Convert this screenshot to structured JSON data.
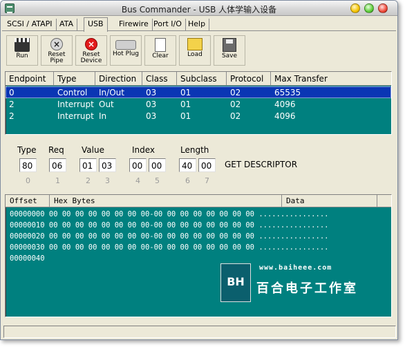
{
  "window": {
    "title": "Bus Commander - USB 人体学输入设备",
    "colors": {
      "table_bg": "#00807f",
      "selection": "#0a36b4",
      "chrome": "#ece9d8"
    }
  },
  "tabs": [
    {
      "label": "SCSI / ATAPI"
    },
    {
      "label": "ATA"
    },
    {
      "label": "USB",
      "active": true
    },
    {
      "label": "Firewire"
    },
    {
      "label": "Port I/O"
    },
    {
      "label": "Help"
    }
  ],
  "toolbar": {
    "run": {
      "label": "Run",
      "icon": "clapperboard-icon"
    },
    "reset_pipe": {
      "label_1": "Reset",
      "label_2": "Pipe",
      "icon": "reset-pipe-icon"
    },
    "reset_device": {
      "label_1": "Reset",
      "label_2": "Device",
      "icon": "reset-device-icon"
    },
    "hot_plug": {
      "label": "Hot Plug",
      "icon": "usb-plug-icon"
    },
    "clear": {
      "label": "Clear",
      "icon": "blank-page-icon"
    },
    "load": {
      "label": "Load",
      "icon": "folder-icon"
    },
    "save": {
      "label": "Save",
      "icon": "floppy-disk-icon"
    }
  },
  "endpoints": {
    "headers": [
      "Endpoint",
      "Type",
      "Direction",
      "Class",
      "Subclass",
      "Protocol",
      "Max Transfer"
    ],
    "rows": [
      {
        "endpoint": "0",
        "type": "Control",
        "direction": "In/Out",
        "class": "03",
        "subclass": "01",
        "protocol": "02",
        "max": "65535",
        "selected": true
      },
      {
        "endpoint": "2",
        "type": "Interrupt",
        "direction": "Out",
        "class": "03",
        "subclass": "01",
        "protocol": "02",
        "max": "4096"
      },
      {
        "endpoint": "2",
        "type": "Interrupt",
        "direction": "In",
        "class": "03",
        "subclass": "01",
        "protocol": "02",
        "max": "4096"
      }
    ]
  },
  "request": {
    "labels": {
      "type": "Type",
      "req": "Req",
      "value": "Value",
      "index": "Index",
      "length": "Length"
    },
    "bytes": [
      "80",
      "06",
      "01",
      "03",
      "00",
      "00",
      "40",
      "00"
    ],
    "indices": [
      "0",
      "1",
      "2",
      "3",
      "4",
      "5",
      "6",
      "7"
    ],
    "description": "GET DESCRIPTOR"
  },
  "hexdump": {
    "headers": {
      "offset": "Offset",
      "hex": "Hex Bytes",
      "data": "Data"
    },
    "lines": [
      "00000000 00 00 00 00 00 00 00 00-00 00 00 00 00 00 00 00 ................",
      "00000010 00 00 00 00 00 00 00 00-00 00 00 00 00 00 00 00 ................",
      "00000020 00 00 00 00 00 00 00 00-00 00 00 00 00 00 00 00 ................",
      "00000030 00 00 00 00 00 00 00 00-00 00 00 00 00 00 00 00 ................",
      "00000040"
    ]
  },
  "watermark": {
    "logo": "BH",
    "url": "www.baiheee.com",
    "name": "百合电子工作室"
  }
}
